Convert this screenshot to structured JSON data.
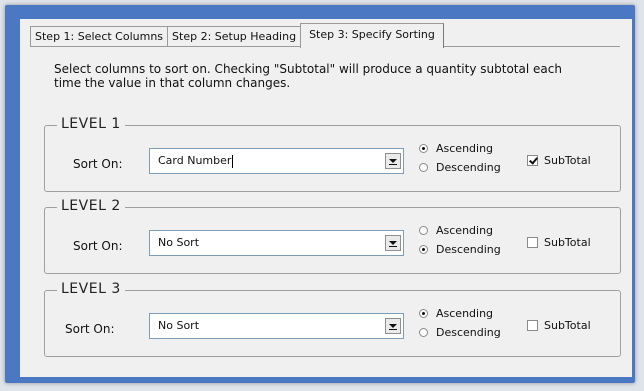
{
  "tabs": [
    {
      "label": "Step 1: Select Columns"
    },
    {
      "label": "Step 2: Setup Heading"
    },
    {
      "label": "Step 3: Specify Sorting"
    }
  ],
  "instructions": "Select columns to sort on.  Checking \"Subtotal\" will produce a quantity subtotal each time the value in that column changes.",
  "levels": [
    {
      "title": "LEVEL 1",
      "sort_label": "Sort On:",
      "value": "Card Number",
      "ascending": "Ascending",
      "descending": "Descending",
      "order": "Ascending",
      "subtotal_label": "SubTotal",
      "subtotal_checked": true
    },
    {
      "title": "LEVEL 2",
      "sort_label": "Sort On:",
      "value": "No Sort",
      "ascending": "Ascending",
      "descending": "Descending",
      "order": "Descending",
      "subtotal_label": "SubTotal",
      "subtotal_checked": false
    },
    {
      "title": "LEVEL 3",
      "sort_label": "Sort On:",
      "value": "No Sort",
      "ascending": "Ascending",
      "descending": "Descending",
      "order": "Ascending",
      "subtotal_label": "SubTotal",
      "subtotal_checked": false
    }
  ]
}
